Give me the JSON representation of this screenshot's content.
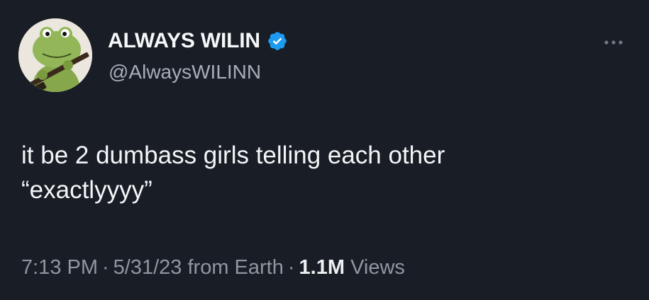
{
  "author": {
    "display_name": "ALWAYS WILIN",
    "handle": "@AlwaysWILINN",
    "verified": true,
    "verified_color": "#1d9bf0",
    "avatar_icon": "frog-with-rifle-avatar"
  },
  "tweet": {
    "text": "it be 2 dumbass girls telling each other\n“exactlyyyy”",
    "time": "7:13 PM",
    "date": "5/31/23",
    "location": "from Earth",
    "views_count": "1.1M",
    "views_label": "Views",
    "separator": "·"
  },
  "icons": {
    "more": "more-dots-icon",
    "verified": "verified-badge-icon"
  },
  "colors": {
    "background": "#181d26",
    "primary_text": "#f2f4f5",
    "secondary_text": "#8f979f"
  }
}
